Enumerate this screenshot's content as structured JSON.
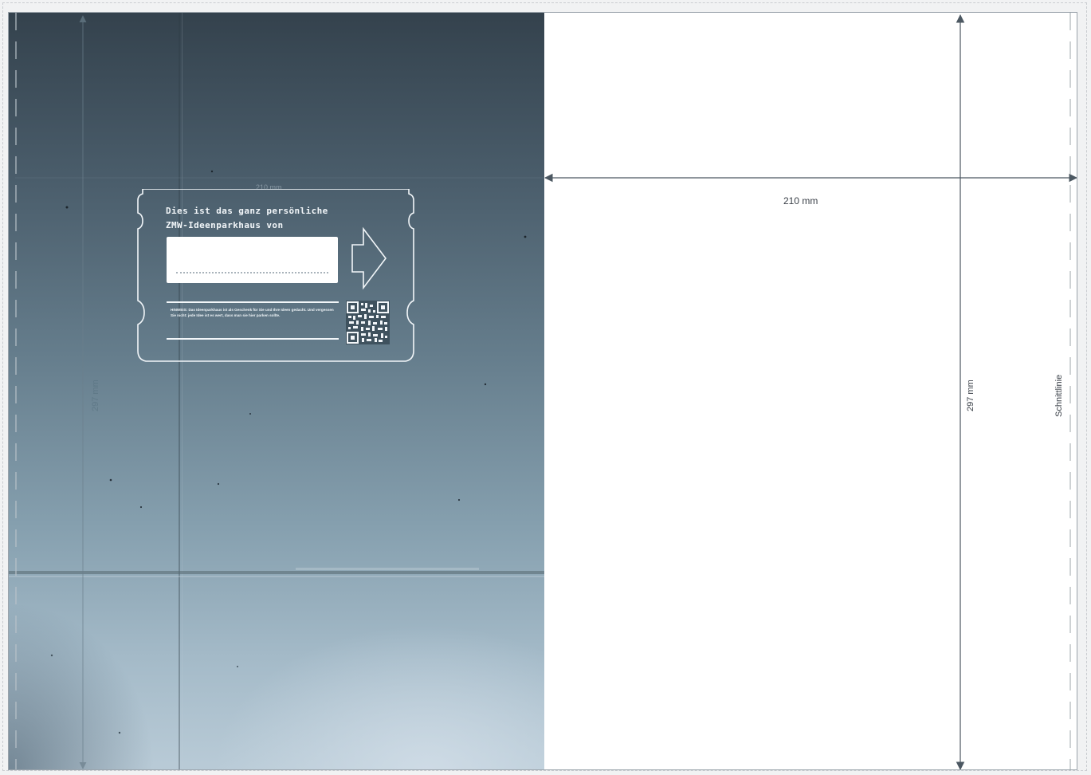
{
  "ticket": {
    "heading_line1": "Dies ist das ganz persönliche",
    "heading_line2": "ZMW-Ideenparkhaus von",
    "note": "HINWEIS: Das Ideenparkhaus ist als Geschenk für Sie und Ihre Ideen gedacht. Und vergessen Sie nicht: jede Idee ist es wert, dass man sie hier parken sollte."
  },
  "dimensions": {
    "width_label": "210 mm",
    "height_label": "297 mm",
    "height_label_faint": "297 mm",
    "width_label_faint": "210 mm"
  },
  "annotations": {
    "cut_line_label": "Schnittlinie"
  },
  "colors": {
    "dimension_line": "#4c5862",
    "cut_line": "#aeb3b8"
  },
  "icons": [
    "arrow-right-icon",
    "qr-code-icon"
  ]
}
